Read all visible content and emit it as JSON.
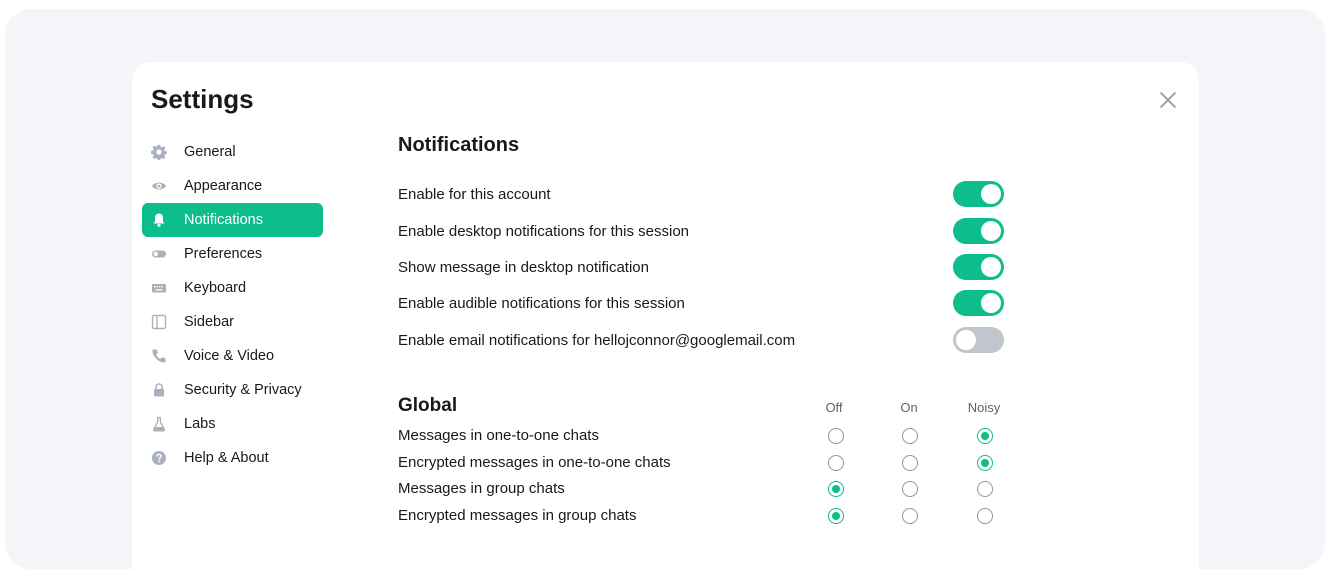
{
  "dialog": {
    "title": "Settings",
    "close_icon": "close-icon"
  },
  "sidebar": {
    "items": [
      {
        "label": "General",
        "icon": "gear-icon",
        "active": false
      },
      {
        "label": "Appearance",
        "icon": "eye-icon",
        "active": false
      },
      {
        "label": "Notifications",
        "icon": "bell-icon",
        "active": true
      },
      {
        "label": "Preferences",
        "icon": "toggle-icon",
        "active": false
      },
      {
        "label": "Keyboard",
        "icon": "keyboard-icon",
        "active": false
      },
      {
        "label": "Sidebar",
        "icon": "sidebar-icon",
        "active": false
      },
      {
        "label": "Voice & Video",
        "icon": "phone-icon",
        "active": false
      },
      {
        "label": "Security & Privacy",
        "icon": "lock-icon",
        "active": false
      },
      {
        "label": "Labs",
        "icon": "flask-icon",
        "active": false
      },
      {
        "label": "Help & About",
        "icon": "help-icon",
        "active": false
      }
    ]
  },
  "notifications": {
    "heading": "Notifications",
    "toggles": [
      {
        "label": "Enable for this account",
        "on": true
      },
      {
        "label": "Enable desktop notifications for this session",
        "on": true
      },
      {
        "label": "Show message in desktop notification",
        "on": true
      },
      {
        "label": "Enable audible notifications for this session",
        "on": true
      },
      {
        "label": "Enable email notifications for hellojconnor@googlemail.com",
        "on": false
      }
    ]
  },
  "global": {
    "heading": "Global",
    "columns": [
      "Off",
      "On",
      "Noisy"
    ],
    "rows": [
      {
        "label": "Messages in one-to-one chats",
        "selected": "Noisy"
      },
      {
        "label": "Encrypted messages in one-to-one chats",
        "selected": "Noisy"
      },
      {
        "label": "Messages in group chats",
        "selected": "Off"
      },
      {
        "label": "Encrypted messages in group chats",
        "selected": "Off"
      }
    ]
  },
  "colors": {
    "accent": "#0dbd8b",
    "toggle_off": "#c1c6cd",
    "backdrop": "#f4f5f8"
  }
}
